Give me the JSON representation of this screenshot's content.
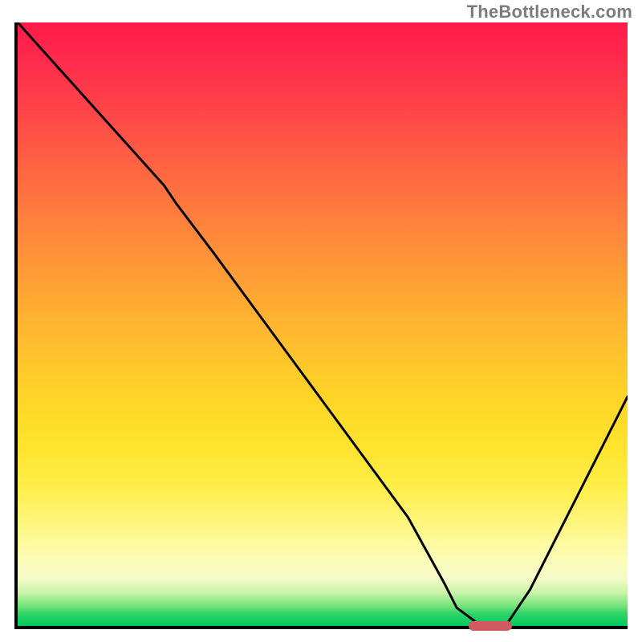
{
  "watermark": "TheBottleneck.com",
  "colors": {
    "curve_stroke": "#000000",
    "marker_fill": "#d05a60",
    "axis_color": "#000000"
  },
  "chart_data": {
    "type": "line",
    "title": "",
    "xlabel": "",
    "ylabel": "",
    "xlim": [
      0,
      100
    ],
    "ylim": [
      0,
      100
    ],
    "x": [
      0,
      8,
      16,
      24,
      26,
      32,
      40,
      48,
      56,
      64,
      70,
      72,
      76,
      80,
      84,
      90,
      96,
      100
    ],
    "values": [
      100,
      91,
      82,
      73,
      70,
      62,
      51,
      40,
      29,
      18,
      7,
      3,
      0,
      0,
      6,
      18,
      30,
      38
    ],
    "marker": {
      "x_start": 74,
      "x_end": 81,
      "y": 0
    },
    "gradient_note": "vertical heat gradient red→yellow→green representing bottleneck severity"
  }
}
